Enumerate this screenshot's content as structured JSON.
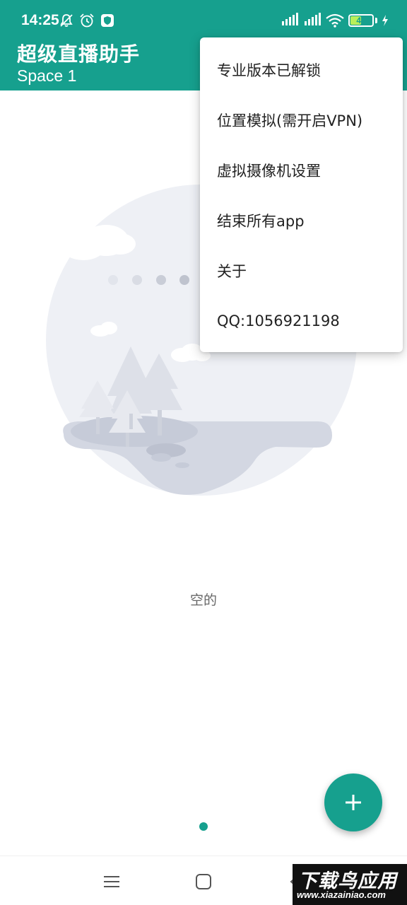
{
  "status_bar": {
    "time": "14:25",
    "battery": "48",
    "left_icons": [
      "muted-bell-icon",
      "alarm-icon",
      "vpn-shield-icon"
    ],
    "right_icons": [
      "hd-signal-icon",
      "hd-signal-icon",
      "wifi-icon",
      "battery-icon",
      "charging-icon"
    ]
  },
  "appbar": {
    "title": "超级直播助手",
    "subtitle": "Space 1"
  },
  "menu": {
    "items": [
      {
        "label": "专业版本已解锁"
      },
      {
        "label": "位置模拟(需开启VPN)"
      },
      {
        "label": "虚拟摄像机设置"
      },
      {
        "label": "结束所有app"
      },
      {
        "label": "关于"
      },
      {
        "label": "QQ:1056921198"
      }
    ]
  },
  "empty_state": {
    "text": "空的",
    "illustration": "empty-landscape-illustration"
  },
  "fab": {
    "icon": "plus-icon"
  },
  "nav": {
    "icons": [
      "menu-icon",
      "home-icon",
      "back-icon"
    ]
  },
  "watermark": {
    "title": "下载鸟应用",
    "url": "www.xiazainiao.com"
  },
  "colors": {
    "primary": "#16a08e",
    "background": "#ffffff",
    "illustration": "#eef0f5"
  }
}
